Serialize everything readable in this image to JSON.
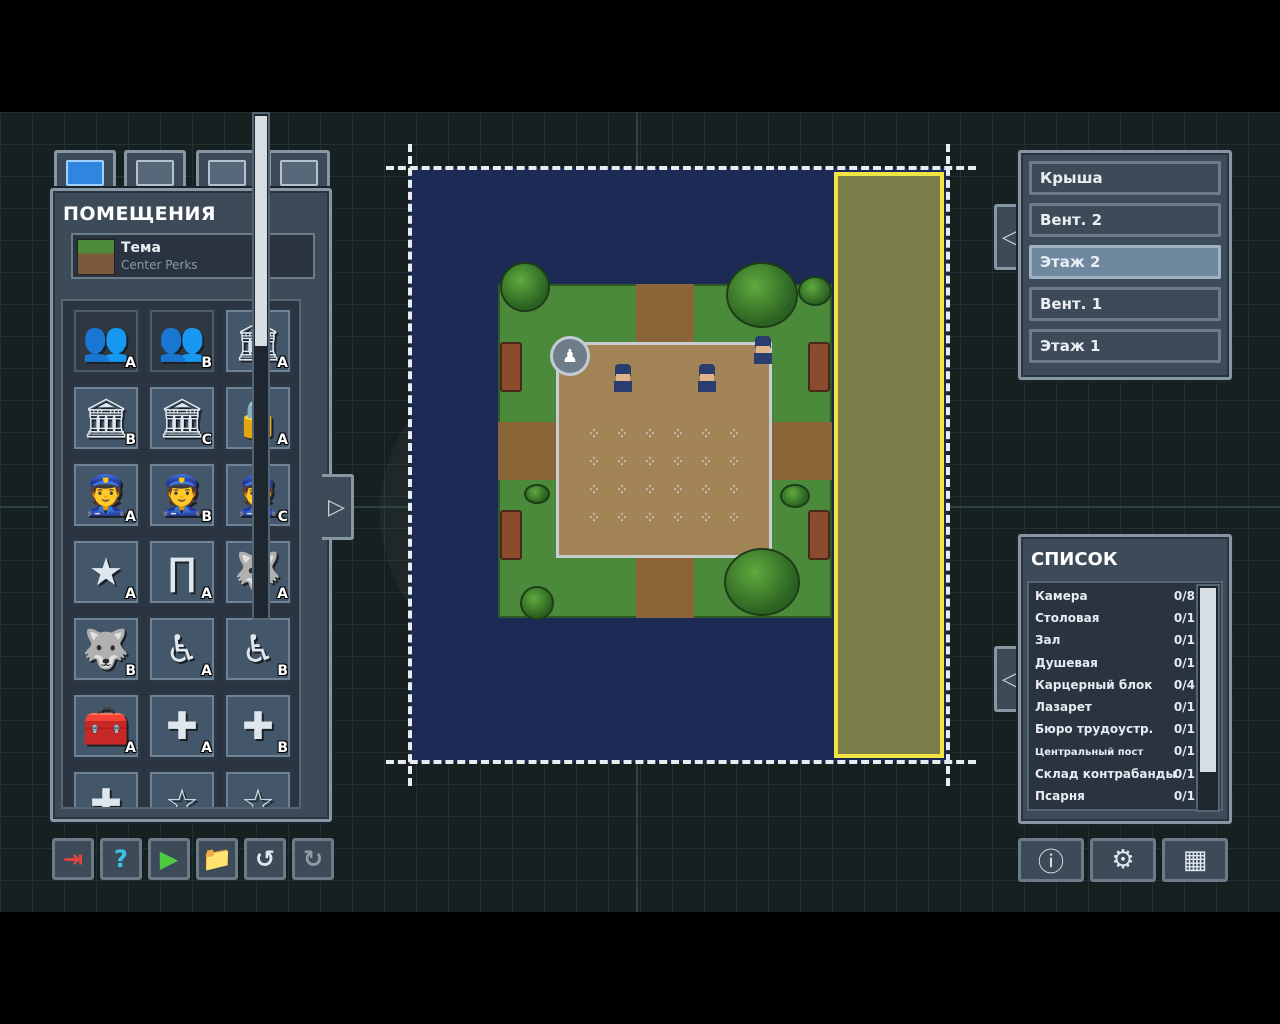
{
  "left_panel": {
    "tabs": [
      {
        "name": "blueprint-tab-icon",
        "active": true
      },
      {
        "name": "info-edit-tab-icon",
        "active": false
      },
      {
        "name": "objects-tab-icon",
        "active": false
      },
      {
        "name": "tiles-tab-icon",
        "active": false
      }
    ],
    "title": "ПОМЕЩЕНИЯ",
    "theme": {
      "label": "Тема",
      "value": "Center Perks"
    },
    "rooms": [
      {
        "icon": "inmates-group-icon",
        "glyph": "👥",
        "variant": "A",
        "locked": true
      },
      {
        "icon": "inmates-group-icon",
        "glyph": "👥",
        "variant": "B",
        "locked": true
      },
      {
        "icon": "prison-building-icon",
        "glyph": "🏛",
        "variant": "A",
        "locked": false
      },
      {
        "icon": "prison-building-icon",
        "glyph": "🏛",
        "variant": "B",
        "locked": false
      },
      {
        "icon": "prison-building-icon",
        "glyph": "🏛",
        "variant": "C",
        "locked": false
      },
      {
        "icon": "padlock-icon",
        "glyph": "🔒",
        "variant": "A",
        "locked": false
      },
      {
        "icon": "guard-head-icon",
        "glyph": "👮",
        "variant": "A",
        "locked": false
      },
      {
        "icon": "guard-head-icon",
        "glyph": "👮",
        "variant": "B",
        "locked": false
      },
      {
        "icon": "guard-head-icon",
        "glyph": "👮",
        "variant": "C",
        "locked": false
      },
      {
        "icon": "star-icon",
        "glyph": "★",
        "variant": "A",
        "locked": false
      },
      {
        "icon": "metal-detector-icon",
        "glyph": "∏",
        "variant": "A",
        "locked": false
      },
      {
        "icon": "guard-dog-icon",
        "glyph": "🐺",
        "variant": "A",
        "locked": false
      },
      {
        "icon": "guard-dog-icon",
        "glyph": "🐺",
        "variant": "B",
        "locked": false
      },
      {
        "icon": "wheelchair-icon",
        "glyph": "♿",
        "variant": "A",
        "locked": false
      },
      {
        "icon": "wheelchair-icon",
        "glyph": "♿",
        "variant": "B",
        "locked": false
      },
      {
        "icon": "toolbox-icon",
        "glyph": "🧰",
        "variant": "A",
        "locked": false
      },
      {
        "icon": "medkit-icon",
        "glyph": "✚",
        "variant": "A",
        "locked": false
      },
      {
        "icon": "medkit-icon",
        "glyph": "✚",
        "variant": "B",
        "locked": false
      },
      {
        "icon": "medkit-icon",
        "glyph": "✚",
        "variant": "",
        "locked": false
      },
      {
        "icon": "star-icon",
        "glyph": "☆",
        "variant": "",
        "locked": false
      },
      {
        "icon": "star-icon",
        "glyph": "☆",
        "variant": "",
        "locked": false
      }
    ]
  },
  "toolbar_left": [
    {
      "name": "exit-icon",
      "glyph": "⇥",
      "color": "#e8423f"
    },
    {
      "name": "help-icon",
      "glyph": "?",
      "color": "#3ec0e8"
    },
    {
      "name": "play-icon",
      "glyph": "▶",
      "color": "#4fc842"
    },
    {
      "name": "folder-icon",
      "glyph": "📁",
      "color": "#e8b84a"
    },
    {
      "name": "undo-icon",
      "glyph": "↺",
      "color": "#dfe7ee"
    },
    {
      "name": "redo-icon",
      "glyph": "↻",
      "color": "#8e9aa5"
    }
  ],
  "floors": {
    "items": [
      "Крыша",
      "Вент. 2",
      "Этаж 2",
      "Вент. 1",
      "Этаж 1"
    ],
    "active_index": 2
  },
  "list": {
    "title": "СПИСОК",
    "rows": [
      {
        "name": "Камера",
        "count": "0/8"
      },
      {
        "name": "Столовая",
        "count": "0/1"
      },
      {
        "name": "Зал",
        "count": "0/1"
      },
      {
        "name": "Душевая",
        "count": "0/1"
      },
      {
        "name": "Карцерный блок",
        "count": "0/4"
      },
      {
        "name": "Лазарет",
        "count": "0/1"
      },
      {
        "name": "Бюро трудоустр.",
        "count": "0/1"
      },
      {
        "name": "Центральный пост",
        "count": "0/1"
      },
      {
        "name": "Склад контрабанды",
        "count": "0/1"
      },
      {
        "name": "Псарня",
        "count": "0/1"
      }
    ]
  },
  "toolbar_right": [
    {
      "name": "info-icon",
      "glyph": "ⓘ"
    },
    {
      "name": "settings-gear-icon",
      "glyph": "⚙"
    },
    {
      "name": "grid-view-icon",
      "glyph": "▦"
    }
  ],
  "colors": {
    "selection_border": "#f0e543",
    "map_background": "#1d2a56",
    "active_floor": "#6f88a0"
  }
}
